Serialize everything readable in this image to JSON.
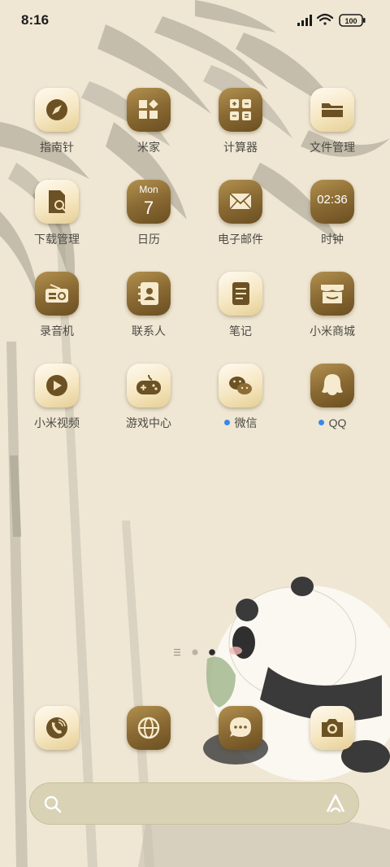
{
  "status_bar": {
    "time": "8:16",
    "battery": "100"
  },
  "apps": [
    {
      "label": "指南针",
      "icon": "compass-icon",
      "style": "light"
    },
    {
      "label": "米家",
      "icon": "mijia-icon",
      "style": "dark"
    },
    {
      "label": "计算器",
      "icon": "calculator-icon",
      "style": "dark"
    },
    {
      "label": "文件管理",
      "icon": "folder-icon",
      "style": "light"
    },
    {
      "label": "下载管理",
      "icon": "download-manager-icon",
      "style": "light"
    },
    {
      "label": "日历",
      "icon": "calendar-icon",
      "style": "dark"
    },
    {
      "label": "电子邮件",
      "icon": "mail-icon",
      "style": "dark"
    },
    {
      "label": "时钟",
      "icon": "clock-icon",
      "style": "dark"
    },
    {
      "label": "录音机",
      "icon": "radio-icon",
      "style": "dark"
    },
    {
      "label": "联系人",
      "icon": "contacts-icon",
      "style": "dark"
    },
    {
      "label": "笔记",
      "icon": "notes-icon",
      "style": "light"
    },
    {
      "label": "小米商城",
      "icon": "store-icon",
      "style": "dark"
    },
    {
      "label": "小米视频",
      "icon": "video-play-icon",
      "style": "light"
    },
    {
      "label": "游戏中心",
      "icon": "gamepad-icon",
      "style": "light"
    },
    {
      "label": "微信",
      "icon": "wechat-icon",
      "style": "light",
      "notification_dot": true
    },
    {
      "label": "QQ",
      "icon": "qq-penguin-icon",
      "style": "dark",
      "notification_dot": true
    }
  ],
  "calendar": {
    "weekday": "Mon",
    "day": "7"
  },
  "clock": {
    "time": "02:36"
  },
  "page_indicator": {
    "pages": 2,
    "active": 2
  },
  "dock": [
    {
      "icon": "phone-icon",
      "style": "light"
    },
    {
      "icon": "browser-icon",
      "style": "dark"
    },
    {
      "icon": "messages-icon",
      "style": "dark"
    },
    {
      "icon": "camera-icon",
      "style": "light"
    }
  ],
  "colors": {
    "accent": "#3a86f0",
    "icon_dark": "#8a6a33",
    "icon_light": "#f6e7c2",
    "search_bg": "#d9d2b5"
  }
}
